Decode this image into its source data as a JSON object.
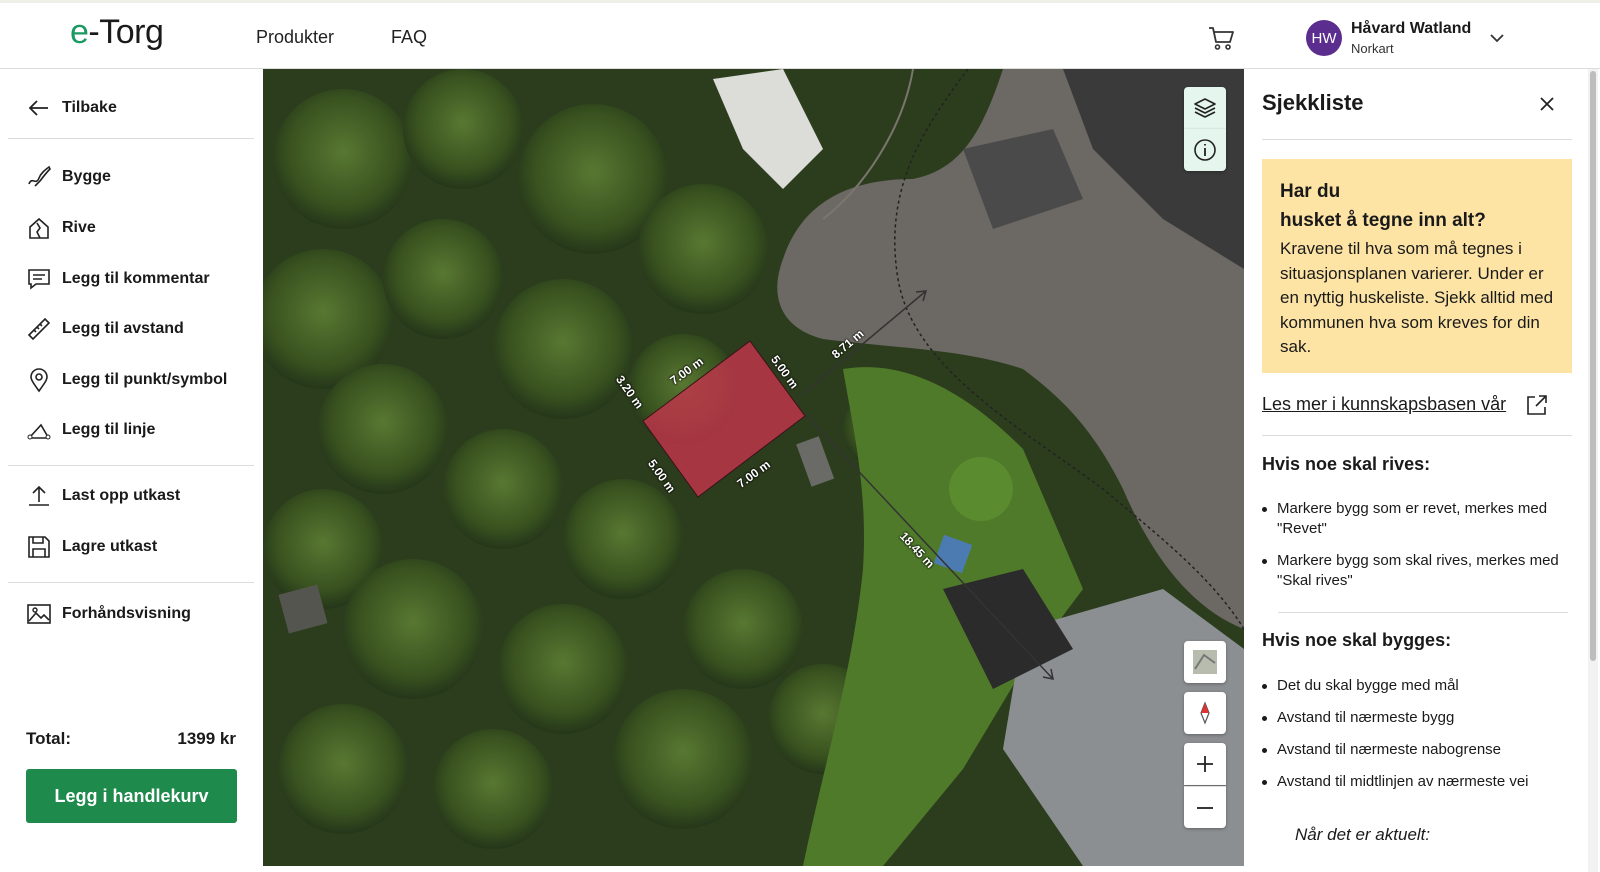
{
  "header": {
    "logo_prefix": "e",
    "logo_rest": "-Torg",
    "nav": [
      {
        "label": "Produkter"
      },
      {
        "label": "FAQ"
      }
    ],
    "user": {
      "initials": "HW",
      "name": "Håvard Watland",
      "org": "Norkart"
    },
    "colors": {
      "brand_green": "#1a9a62",
      "avatar": "#5b2d8e"
    }
  },
  "sidebar": {
    "back_label": "Tilbake",
    "tools": [
      {
        "label": "Bygge",
        "icon": "draw-icon"
      },
      {
        "label": "Rive",
        "icon": "demolish-house-icon"
      },
      {
        "label": "Legg til kommentar",
        "icon": "comment-icon"
      },
      {
        "label": "Legg til avstand",
        "icon": "ruler-icon"
      },
      {
        "label": "Legg til punkt/symbol",
        "icon": "pin-icon"
      },
      {
        "label": "Legg til linje",
        "icon": "line-icon"
      }
    ],
    "draft_actions": [
      {
        "label": "Last opp utkast",
        "icon": "upload-icon"
      },
      {
        "label": "Lagre utkast",
        "icon": "save-icon"
      }
    ],
    "preview_label": "Forhåndsvisning",
    "total_label": "Total:",
    "total_value": "1399 kr",
    "cart_button": "Legg i handlekurv",
    "button_color": "#1e8a4c"
  },
  "map": {
    "measurements": [
      {
        "label": "7.00 m"
      },
      {
        "label": "5.00 m"
      },
      {
        "label": "3.20 m"
      },
      {
        "label": "5.00 m"
      },
      {
        "label": "7.00 m"
      },
      {
        "label": "8.71 m"
      },
      {
        "label": "18.45 m"
      }
    ],
    "building_fill": "#c0344a",
    "controls": [
      "layers-icon",
      "info-icon",
      "basemap-thumbnail",
      "compass-icon",
      "zoom-in-icon",
      "zoom-out-icon"
    ]
  },
  "checklist": {
    "title": "Sjekkliste",
    "warning_title_line1": "Har du",
    "warning_title_line2": "husket å tegne inn alt?",
    "warning_body": "Kravene til hva som må tegnes i situasjonsplanen varierer. Under er en nyttig huskeliste. Sjekk alltid med kommunen hva som kreves for din sak.",
    "warning_bg": "#fde4a4",
    "kb_link": "Les mer i kunnskapsbasen vår",
    "demolish_title": "Hvis noe skal rives:",
    "demolish_items": [
      "Markere bygg som er revet, merkes med \"Revet\"",
      "Markere bygg som skal rives, merkes med \"Skal rives\""
    ],
    "build_title": "Hvis noe skal bygges:",
    "build_items": [
      "Det du skal bygge med mål",
      "Avstand til nærmeste bygg",
      "Avstand til nærmeste nabogrense",
      "Avstand til midtlinjen av nærmeste vei"
    ],
    "when_relevant": "Når det er aktuelt:"
  }
}
